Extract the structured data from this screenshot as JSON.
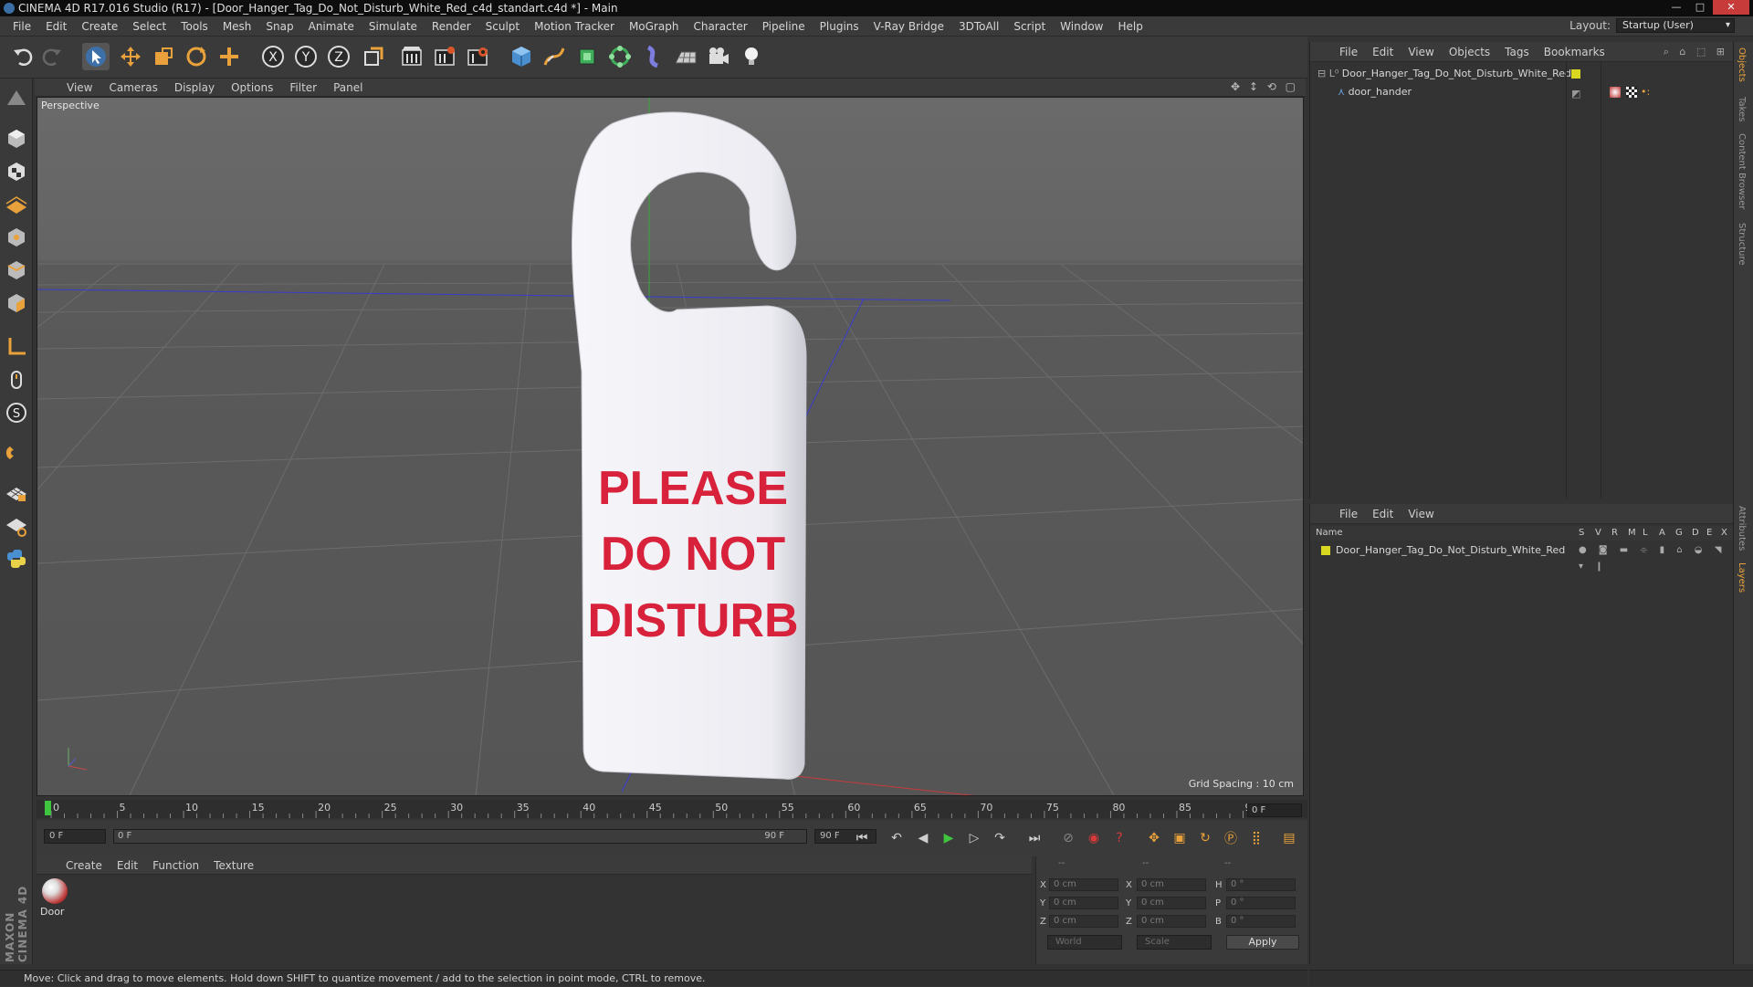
{
  "window": {
    "title": "CINEMA 4D R17.016 Studio (R17) - [Door_Hanger_Tag_Do_Not_Disturb_White_Red_c4d_standart.c4d *] - Main"
  },
  "menubar": {
    "items": [
      "File",
      "Edit",
      "Create",
      "Select",
      "Tools",
      "Mesh",
      "Snap",
      "Animate",
      "Simulate",
      "Render",
      "Sculpt",
      "Motion Tracker",
      "MoGraph",
      "Character",
      "Pipeline",
      "Plugins",
      "V-Ray Bridge",
      "3DToAll",
      "Script",
      "Window",
      "Help"
    ],
    "layout_label": "Layout:",
    "layout_value": "Startup (User)"
  },
  "toolbar": {
    "icons": [
      "undo-icon",
      "redo-icon",
      "select-arrow-icon",
      "move-icon",
      "scale-icon",
      "rotate-icon",
      "move-add-icon",
      "x-axis-icon",
      "y-axis-icon",
      "z-axis-icon",
      "coordinate-system-icon",
      "render-view-icon",
      "render-picture-viewer-icon",
      "render-settings-icon",
      "cube-icon",
      "pen-spline-icon",
      "nurbs-icon",
      "array-icon",
      "deformer-icon",
      "floor-icon",
      "camera-icon",
      "light-icon"
    ]
  },
  "viewport": {
    "menu": [
      "View",
      "Cameras",
      "Display",
      "Options",
      "Filter",
      "Panel"
    ],
    "label": "Perspective",
    "grid_spacing": "Grid Spacing : 10 cm",
    "sign_text": [
      "PLEASE",
      "DO NOT",
      "DISTURB"
    ],
    "colors": {
      "sign_text": "#d8213a",
      "sign_body": "#eeeef2"
    }
  },
  "timeline": {
    "ticks": [
      "0",
      "5",
      "10",
      "15",
      "20",
      "25",
      "30",
      "35",
      "40",
      "45",
      "50",
      "55",
      "60",
      "65",
      "70",
      "75",
      "80",
      "85",
      "90"
    ],
    "current_frame": "0 F"
  },
  "transport": {
    "start_field": "0 F",
    "range_start": "0 F",
    "range_end": "90 F",
    "end_field": "90 F"
  },
  "material_manager": {
    "menu": [
      "Create",
      "Edit",
      "Function",
      "Texture"
    ],
    "materials": [
      {
        "name": "Door"
      }
    ]
  },
  "coordinates": {
    "header": [
      "--",
      "--",
      "--"
    ],
    "rows": [
      {
        "pos_label": "X",
        "pos": "0 cm",
        "size_label": "X",
        "size": "0 cm",
        "rot_label": "H",
        "rot": "0 °"
      },
      {
        "pos_label": "Y",
        "pos": "0 cm",
        "size_label": "Y",
        "size": "0 cm",
        "rot_label": "P",
        "rot": "0 °"
      },
      {
        "pos_label": "Z",
        "pos": "0 cm",
        "size_label": "Z",
        "size": "0 cm",
        "rot_label": "B",
        "rot": "0 °"
      }
    ],
    "mode_world": "World",
    "mode_scale": "Scale",
    "apply": "Apply"
  },
  "status": {
    "text": "Move: Click and drag to move elements. Hold down SHIFT to quantize movement / add to the selection in point mode, CTRL to remove."
  },
  "object_manager": {
    "menu": [
      "File",
      "Edit",
      "View",
      "Objects",
      "Tags",
      "Bookmarks"
    ],
    "objects": [
      {
        "name": "Door_Hanger_Tag_Do_Not_Disturb_White_Red"
      },
      {
        "name": "door_hander"
      }
    ]
  },
  "layer_manager": {
    "menu": [
      "File",
      "Edit",
      "View"
    ],
    "col_name": "Name",
    "col_flags": [
      "S",
      "V",
      "R",
      "M",
      "L",
      "A",
      "G",
      "D",
      "E",
      "X"
    ],
    "layers": [
      {
        "name": "Door_Hanger_Tag_Do_Not_Disturb_White_Red",
        "color": "#d8d820"
      }
    ]
  },
  "right_tabs": [
    "Objects",
    "Takes",
    "Content Browser",
    "Structure",
    "Attributes",
    "Layers"
  ],
  "brand": "MAXON CINEMA 4D"
}
